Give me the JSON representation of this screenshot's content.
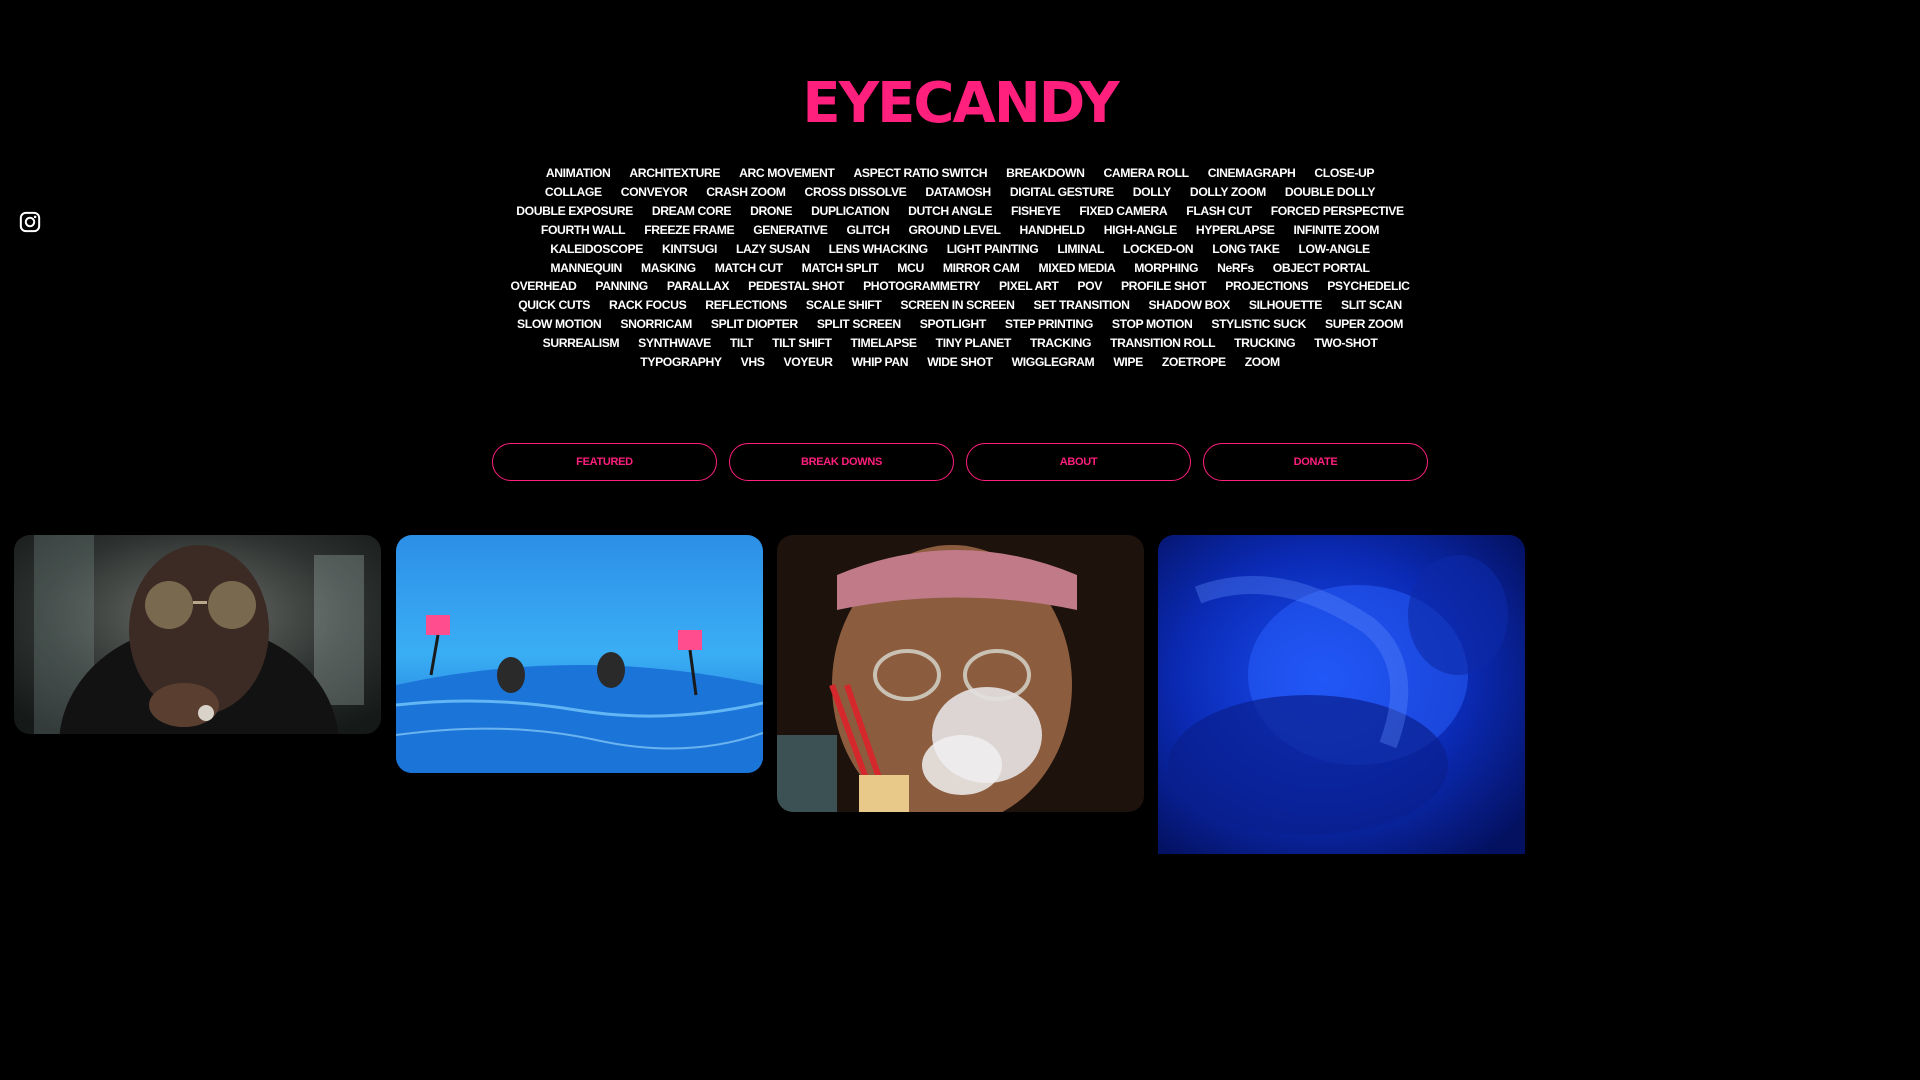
{
  "header": {
    "logo_text": "EYECANDY"
  },
  "social": {
    "instagram_icon": "instagram-icon"
  },
  "tags": [
    "ANIMATION",
    "ARCHITEXTURE",
    "ARC MOVEMENT",
    "ASPECT RATIO SWITCH",
    "BREAKDOWN",
    "CAMERA ROLL",
    "CINEMAGRAPH",
    "CLOSE-UP",
    "COLLAGE",
    "CONVEYOR",
    "CRASH ZOOM",
    "CROSS DISSOLVE",
    "DATAMOSH",
    "DIGITAL GESTURE",
    "DOLLY",
    "DOLLY ZOOM",
    "DOUBLE DOLLY",
    "DOUBLE EXPOSURE",
    "DREAM CORE",
    "DRONE",
    "DUPLICATION",
    "DUTCH ANGLE",
    "FISHEYE",
    "FIXED CAMERA",
    "FLASH CUT",
    "FORCED PERSPECTIVE",
    "FOURTH WALL",
    "FREEZE FRAME",
    "GENERATIVE",
    "GLITCH",
    "GROUND LEVEL",
    "HANDHELD",
    "HIGH-ANGLE",
    "HYPERLAPSE",
    "INFINITE ZOOM",
    "KALEIDOSCOPE",
    "KINTSUGI",
    "LAZY SUSAN",
    "LENS WHACKING",
    "LIGHT PAINTING",
    "LIMINAL",
    "LOCKED-ON",
    "LONG TAKE",
    "LOW-ANGLE",
    "MANNEQUIN",
    "MASKING",
    "MATCH CUT",
    "MATCH SPLIT",
    "MCU",
    "MIRROR CAM",
    "MIXED MEDIA",
    "MORPHING",
    "NeRFs",
    "OBJECT PORTAL",
    "OVERHEAD",
    "PANNING",
    "PARALLAX",
    "PEDESTAL SHOT",
    "PHOTOGRAMMETRY",
    "PIXEL ART",
    "POV",
    "PROFILE SHOT",
    "PROJECTIONS",
    "PSYCHEDELIC",
    "QUICK CUTS",
    "RACK FOCUS",
    "REFLECTIONS",
    "SCALE SHIFT",
    "SCREEN IN SCREEN",
    "SET TRANSITION",
    "SHADOW BOX",
    "SILHOUETTE",
    "SLIT SCAN",
    "SLOW MOTION",
    "SNORRICAM",
    "SPLIT DIOPTER",
    "SPLIT SCREEN",
    "SPOTLIGHT",
    "STEP PRINTING",
    "STOP MOTION",
    "STYLISTIC SUCK",
    "SUPER ZOOM",
    "SURREALISM",
    "SYNTHWAVE",
    "TILT",
    "TILT SHIFT",
    "TIMELAPSE",
    "TINY PLANET",
    "TRACKING",
    "TRANSITION ROLL",
    "TRUCKING",
    "TWO-SHOT",
    "TYPOGRAPHY",
    "VHS",
    "VOYEUR",
    "WHIP PAN",
    "WIDE SHOT",
    "WIGGLEGRAM",
    "WIPE",
    "ZOETROPE",
    "ZOOM"
  ],
  "nav": {
    "featured": "FEATURED",
    "breakdowns": "BREAK DOWNS",
    "about": "ABOUT",
    "donate": "DONATE"
  },
  "colors": {
    "accent": "#ff1f7d",
    "background": "#000000",
    "text": "#ffffff"
  }
}
